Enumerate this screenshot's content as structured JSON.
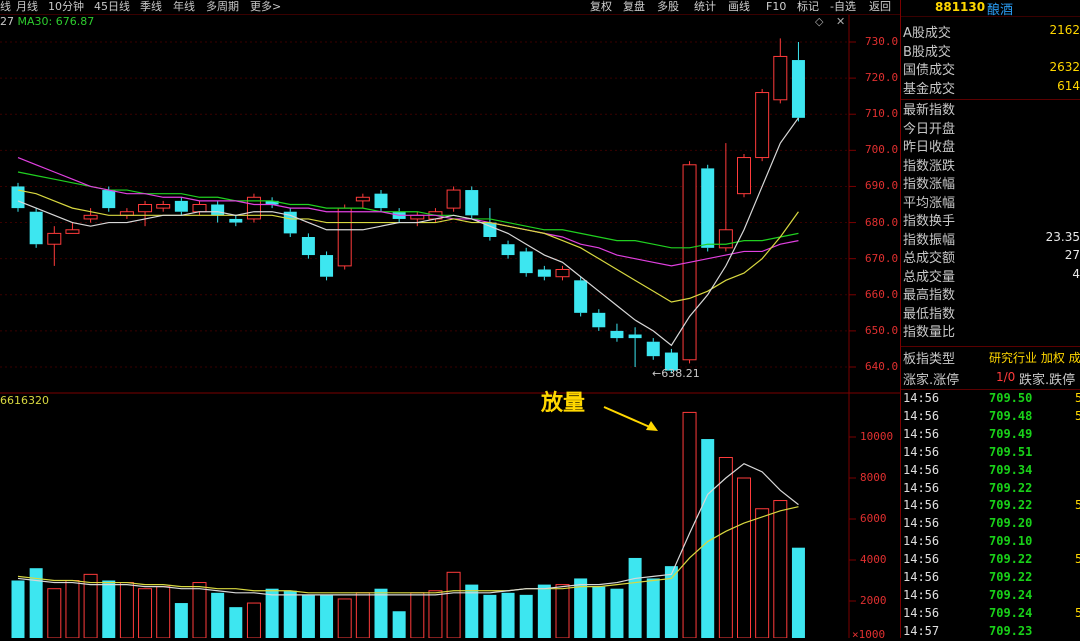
{
  "toolbar": {
    "periods": [
      "线",
      "月线",
      "10分钟",
      "45日线",
      "季线",
      "年线",
      "多周期",
      "更多>"
    ],
    "actions": [
      "复权",
      "复盘",
      "多股",
      "统计",
      "画线",
      "F10",
      "标记",
      "-自选",
      "返回"
    ]
  },
  "indicator": {
    "ma_text": "27",
    "ma30_text": "MA30: 676.87",
    "volume_text": "6616320"
  },
  "annotations": {
    "volume_note": "放量",
    "low_price": "←638.21"
  },
  "axes": {
    "price_ticks": [
      "730.0",
      "720.0",
      "710.0",
      "700.0",
      "690.0",
      "680.0",
      "670.0",
      "660.0",
      "650.0",
      "640.0"
    ],
    "volume_ticks": [
      "10000",
      "8000",
      "6000",
      "4000",
      "2000"
    ],
    "volume_bottom": "×1000"
  },
  "chart_data": {
    "type": "candlestick",
    "price_range": [
      638,
      732
    ],
    "candles": [
      {
        "o": 690,
        "c": 684,
        "h": 691,
        "l": 683
      },
      {
        "o": 683,
        "c": 674,
        "h": 684,
        "l": 673
      },
      {
        "o": 674,
        "c": 677,
        "h": 679,
        "l": 668
      },
      {
        "o": 677,
        "c": 678,
        "h": 680,
        "l": 677
      },
      {
        "o": 681,
        "c": 682,
        "h": 684,
        "l": 680
      },
      {
        "o": 689,
        "c": 684,
        "h": 690,
        "l": 683
      },
      {
        "o": 682,
        "c": 683,
        "h": 684,
        "l": 681
      },
      {
        "o": 683,
        "c": 685,
        "h": 686,
        "l": 679
      },
      {
        "o": 684,
        "c": 685,
        "h": 686,
        "l": 683
      },
      {
        "o": 686,
        "c": 683,
        "h": 687,
        "l": 682
      },
      {
        "o": 683,
        "c": 685,
        "h": 686,
        "l": 682
      },
      {
        "o": 685,
        "c": 682,
        "h": 686,
        "l": 680
      },
      {
        "o": 681,
        "c": 680,
        "h": 682,
        "l": 679
      },
      {
        "o": 681,
        "c": 687,
        "h": 688,
        "l": 680
      },
      {
        "o": 686,
        "c": 685,
        "h": 687,
        "l": 684
      },
      {
        "o": 683,
        "c": 677,
        "h": 684,
        "l": 676
      },
      {
        "o": 676,
        "c": 671,
        "h": 677,
        "l": 670
      },
      {
        "o": 671,
        "c": 665,
        "h": 672,
        "l": 664
      },
      {
        "o": 668,
        "c": 684,
        "h": 685,
        "l": 667
      },
      {
        "o": 686,
        "c": 687,
        "h": 688,
        "l": 684
      },
      {
        "o": 688,
        "c": 684,
        "h": 689,
        "l": 683
      },
      {
        "o": 683,
        "c": 681,
        "h": 684,
        "l": 680
      },
      {
        "o": 681,
        "c": 682,
        "h": 683,
        "l": 679
      },
      {
        "o": 681,
        "c": 683,
        "h": 684,
        "l": 680
      },
      {
        "o": 684,
        "c": 689,
        "h": 690,
        "l": 683
      },
      {
        "o": 689,
        "c": 682,
        "h": 690,
        "l": 681
      },
      {
        "o": 680,
        "c": 676,
        "h": 684,
        "l": 675
      },
      {
        "o": 674,
        "c": 671,
        "h": 675,
        "l": 670
      },
      {
        "o": 672,
        "c": 666,
        "h": 673,
        "l": 665
      },
      {
        "o": 667,
        "c": 665,
        "h": 668,
        "l": 664
      },
      {
        "o": 665,
        "c": 667,
        "h": 668,
        "l": 664
      },
      {
        "o": 664,
        "c": 655,
        "h": 665,
        "l": 654
      },
      {
        "o": 655,
        "c": 651,
        "h": 656,
        "l": 650
      },
      {
        "o": 650,
        "c": 648,
        "h": 652,
        "l": 647
      },
      {
        "o": 649,
        "c": 648,
        "h": 651,
        "l": 640
      },
      {
        "o": 647,
        "c": 643,
        "h": 648,
        "l": 642
      },
      {
        "o": 644,
        "c": 639,
        "h": 645,
        "l": 638.21
      },
      {
        "o": 642,
        "c": 696,
        "h": 697,
        "l": 641
      },
      {
        "o": 695,
        "c": 673,
        "h": 696,
        "l": 672
      },
      {
        "o": 673,
        "c": 678,
        "h": 702,
        "l": 672
      },
      {
        "o": 688,
        "c": 698,
        "h": 699,
        "l": 687
      },
      {
        "o": 698,
        "c": 716,
        "h": 717,
        "l": 697
      },
      {
        "o": 714,
        "c": 726,
        "h": 731,
        "l": 713
      },
      {
        "o": 725,
        "c": 709,
        "h": 730,
        "l": 708
      }
    ],
    "ma_lines": {
      "ma_short_white": [
        686,
        684,
        682,
        680,
        679,
        680,
        680,
        681,
        682,
        682,
        683,
        683,
        682,
        683,
        683,
        682,
        680,
        678,
        678,
        678,
        679,
        680,
        680,
        681,
        682,
        681,
        679,
        677,
        674,
        671,
        669,
        665,
        661,
        657,
        653,
        650,
        646,
        654,
        660,
        668,
        678,
        690,
        702,
        709
      ],
      "ma_yellow": [
        689,
        688,
        686,
        684,
        683,
        682,
        682,
        682,
        682,
        682,
        682,
        682,
        682,
        682,
        682,
        681,
        681,
        680,
        680,
        680,
        680,
        680,
        680,
        680,
        681,
        680,
        680,
        679,
        678,
        677,
        675,
        673,
        670,
        667,
        664,
        661,
        658,
        659,
        661,
        664,
        666,
        670,
        676,
        683
      ],
      "ma_magenta": [
        698,
        696,
        694,
        692,
        690,
        689,
        688,
        688,
        687,
        687,
        686,
        686,
        686,
        685,
        685,
        684,
        684,
        683,
        683,
        683,
        683,
        682,
        682,
        682,
        681,
        681,
        680,
        679,
        678,
        677,
        676,
        674,
        673,
        671,
        670,
        669,
        668,
        669,
        670,
        671,
        672,
        672,
        674,
        675
      ],
      "ma30_green": [
        694,
        693,
        692,
        691,
        690,
        689,
        689,
        688,
        688,
        688,
        687,
        687,
        686,
        686,
        686,
        685,
        685,
        684,
        684,
        684,
        683,
        683,
        683,
        682,
        682,
        681,
        681,
        680,
        679,
        678,
        678,
        677,
        676,
        675,
        675,
        674,
        673,
        673,
        674,
        674,
        675,
        675,
        676,
        677
      ]
    },
    "volume": [
      3000,
      3600,
      2600,
      3000,
      3300,
      3000,
      2900,
      2600,
      2700,
      1900,
      2900,
      2400,
      1700,
      1900,
      2600,
      2500,
      2300,
      2300,
      2100,
      2400,
      2600,
      1500,
      2400,
      2500,
      3400,
      2800,
      2300,
      2400,
      2300,
      2800,
      2800,
      3100,
      2700,
      2600,
      4100,
      3100,
      3700,
      11200,
      9900,
      9000,
      8000,
      6500,
      6900,
      4600
    ],
    "volume_ma_white": [
      3100,
      3000,
      2900,
      2900,
      2800,
      2800,
      2800,
      2700,
      2700,
      2600,
      2600,
      2500,
      2400,
      2400,
      2300,
      2300,
      2300,
      2300,
      2300,
      2300,
      2300,
      2300,
      2300,
      2300,
      2400,
      2400,
      2400,
      2500,
      2600,
      2600,
      2700,
      2800,
      2800,
      2900,
      3100,
      3200,
      3300,
      5300,
      7200,
      8000,
      8700,
      8300,
      7400,
      6700
    ],
    "volume_ma_yellow": [
      3200,
      3100,
      3000,
      3000,
      2900,
      2900,
      2900,
      2800,
      2800,
      2700,
      2700,
      2600,
      2600,
      2500,
      2500,
      2500,
      2400,
      2400,
      2400,
      2400,
      2400,
      2400,
      2400,
      2400,
      2500,
      2500,
      2500,
      2500,
      2600,
      2600,
      2600,
      2700,
      2700,
      2800,
      2900,
      3000,
      3100,
      4100,
      4900,
      5400,
      5800,
      6100,
      6400,
      6600
    ],
    "volume_range": [
      0,
      11500
    ]
  },
  "panel": {
    "code": "881130",
    "name": "酿酒",
    "rows": [
      {
        "label": "A股成交",
        "value": "2162"
      },
      {
        "label": "B股成交",
        "value": ""
      },
      {
        "label": "国债成交",
        "value": "2632"
      },
      {
        "label": "基金成交",
        "value": "614"
      },
      {
        "label": "最新指数",
        "value": ""
      },
      {
        "label": "今日开盘",
        "value": ""
      },
      {
        "label": "昨日收盘",
        "value": ""
      },
      {
        "label": "指数涨跌",
        "value": ""
      },
      {
        "label": "指数涨幅",
        "value": ""
      },
      {
        "label": "平均涨幅",
        "value": ""
      },
      {
        "label": "指数换手",
        "value": ""
      },
      {
        "label": "指数振幅",
        "value": "23.35"
      },
      {
        "label": "总成交额",
        "value": "27"
      },
      {
        "label": "总成交量",
        "value": "4"
      },
      {
        "label": "最高指数",
        "value": ""
      },
      {
        "label": "最低指数",
        "value": ""
      },
      {
        "label": "指数量比",
        "value": ""
      }
    ],
    "type_label": "板指类型",
    "type_value": "研究行业 加权 成",
    "updown_label": "涨家.涨停",
    "updown_value": "1/0",
    "down_label": "跌家.跌停",
    "ticks": [
      {
        "time": "14:56",
        "price": "709.50",
        "dir": "up",
        "vol": "5"
      },
      {
        "time": "14:56",
        "price": "709.48",
        "dir": "up",
        "vol": "5"
      },
      {
        "time": "14:56",
        "price": "709.49",
        "dir": "up",
        "vol": ""
      },
      {
        "time": "14:56",
        "price": "709.51",
        "dir": "up",
        "vol": ""
      },
      {
        "time": "14:56",
        "price": "709.34",
        "dir": "up",
        "vol": ""
      },
      {
        "time": "14:56",
        "price": "709.22",
        "dir": "up",
        "vol": ""
      },
      {
        "time": "14:56",
        "price": "709.22",
        "dir": "down",
        "vol": "5"
      },
      {
        "time": "14:56",
        "price": "709.20",
        "dir": "up",
        "vol": ""
      },
      {
        "time": "14:56",
        "price": "709.10",
        "dir": "up",
        "vol": ""
      },
      {
        "time": "14:56",
        "price": "709.22",
        "dir": "down",
        "vol": "5"
      },
      {
        "time": "14:56",
        "price": "709.22",
        "dir": "up",
        "vol": ""
      },
      {
        "time": "14:56",
        "price": "709.24",
        "dir": "up",
        "vol": ""
      },
      {
        "time": "14:56",
        "price": "709.24",
        "dir": "down",
        "vol": "5"
      },
      {
        "time": "14:57",
        "price": "709.23",
        "dir": "up",
        "vol": ""
      }
    ]
  },
  "colors": {
    "up": "#ff3b3b",
    "down": "#3de6f0",
    "ma_white": "#d8d8d8",
    "ma_yellow": "#d8d840",
    "ma_magenta": "#e040e0",
    "ma_green": "#20d020",
    "grid": "#7a0000"
  }
}
